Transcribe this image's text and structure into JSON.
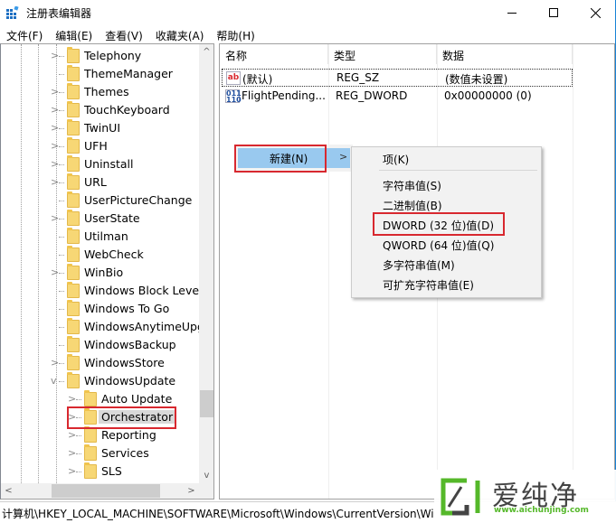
{
  "window": {
    "title": "注册表编辑器",
    "icons": {
      "app": "registry-editor-icon",
      "minimize": "minimize-icon",
      "maximize": "maximize-icon",
      "close": "close-icon"
    }
  },
  "menubar": [
    {
      "label": "文件(F)"
    },
    {
      "label": "编辑(E)"
    },
    {
      "label": "查看(V)"
    },
    {
      "label": "收藏夹(A)"
    },
    {
      "label": "帮助(H)"
    }
  ],
  "tree": {
    "items": [
      {
        "label": "Telephony",
        "expander": ">",
        "level": 1
      },
      {
        "label": "ThemeManager",
        "expander": "",
        "level": 1
      },
      {
        "label": "Themes",
        "expander": ">",
        "level": 1
      },
      {
        "label": "TouchKeyboard",
        "expander": ">",
        "level": 1
      },
      {
        "label": "TwinUI",
        "expander": ">",
        "level": 1
      },
      {
        "label": "UFH",
        "expander": ">",
        "level": 1
      },
      {
        "label": "Uninstall",
        "expander": ">",
        "level": 1
      },
      {
        "label": "URL",
        "expander": ">",
        "level": 1
      },
      {
        "label": "UserPictureChange",
        "expander": "",
        "level": 1
      },
      {
        "label": "UserState",
        "expander": ">",
        "level": 1
      },
      {
        "label": "Utilman",
        "expander": "",
        "level": 1
      },
      {
        "label": "WebCheck",
        "expander": "",
        "level": 1
      },
      {
        "label": "WinBio",
        "expander": ">",
        "level": 1
      },
      {
        "label": "Windows Block Level",
        "expander": "",
        "level": 1
      },
      {
        "label": "Windows To Go",
        "expander": "",
        "level": 1
      },
      {
        "label": "WindowsAnytimeUpgr",
        "expander": "",
        "level": 1
      },
      {
        "label": "WindowsBackup",
        "expander": "",
        "level": 1
      },
      {
        "label": "WindowsStore",
        "expander": ">",
        "level": 1
      },
      {
        "label": "WindowsUpdate",
        "expander": "v",
        "level": 1
      },
      {
        "label": "Auto Update",
        "expander": ">",
        "level": 2
      },
      {
        "label": "Orchestrator",
        "expander": ">",
        "level": 2,
        "selected": true
      },
      {
        "label": "Reporting",
        "expander": ">",
        "level": 2
      },
      {
        "label": "Services",
        "expander": ">",
        "level": 2
      },
      {
        "label": "SLS",
        "expander": ">",
        "level": 2
      }
    ],
    "scroll_up": "^",
    "scroll_down": "v",
    "scroll_left": "<",
    "scroll_right": ">"
  },
  "list": {
    "columns": [
      "名称",
      "类型",
      "数据"
    ],
    "rows": [
      {
        "icon": "ab",
        "name": "(默认)",
        "type": "REG_SZ",
        "data": "(数值未设置)"
      },
      {
        "icon": "011\n110",
        "name": "FlightPending...",
        "type": "REG_DWORD",
        "data": "0x00000000 (0)"
      }
    ]
  },
  "context_menu": {
    "new_label": "新建(N)",
    "arrow": ">",
    "submenu": [
      {
        "label": "项(K)"
      },
      {
        "label": "字符串值(S)"
      },
      {
        "label": "二进制值(B)"
      },
      {
        "label": "DWORD (32 位)值(D)",
        "highlighted": true
      },
      {
        "label": "QWORD (64 位)值(Q)"
      },
      {
        "label": "多字符串值(M)"
      },
      {
        "label": "可扩充字符串值(E)"
      }
    ]
  },
  "statusbar": {
    "path": "计算机\\HKEY_LOCAL_MACHINE\\SOFTWARE\\Microsoft\\Windows\\CurrentVersion\\Wi"
  },
  "watermark": {
    "brand": "爱纯净",
    "url": "www.aichunjing.com",
    "color": "#55b82a"
  },
  "colors": {
    "highlight_border": "#d8282f",
    "menu_hover": "#99c9ef",
    "window_border": "#1883d7"
  }
}
